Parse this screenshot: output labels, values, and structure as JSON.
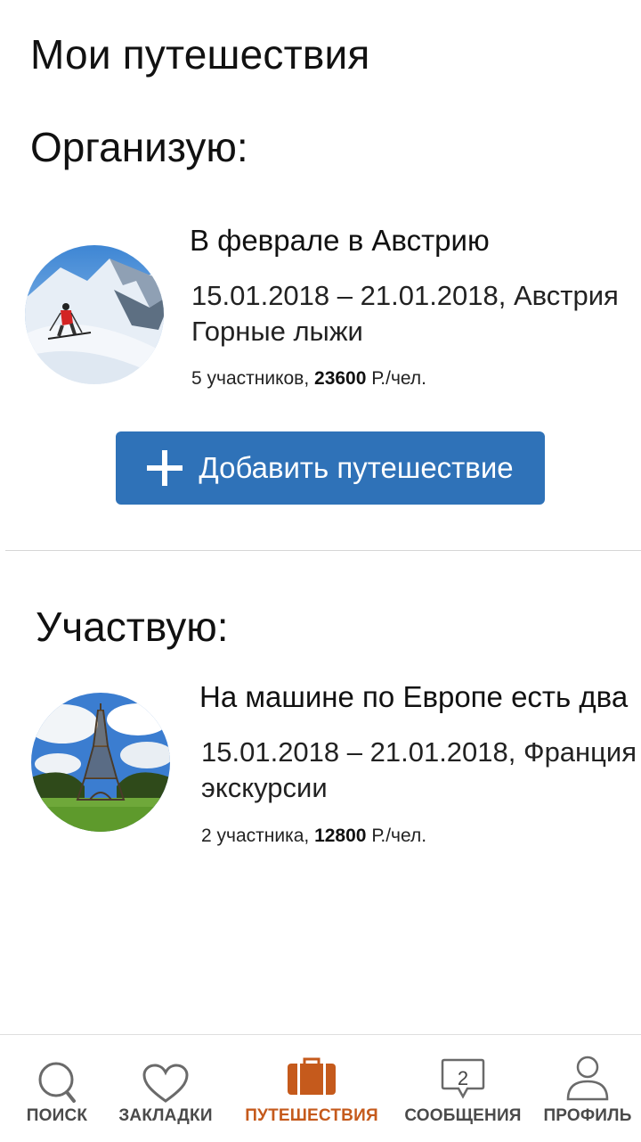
{
  "page": {
    "title": "Мои путешествия"
  },
  "organizing": {
    "section_title": "Организую:",
    "trips": [
      {
        "title": "В феврале в Австрию",
        "dates_location": "15.01.2018 – 21.01.2018, Австрия",
        "category": "Горные лыжи",
        "participants": "5 участников, ",
        "price": "23600",
        "price_unit": " Р./чел."
      }
    ],
    "add_button_label": "Добавить путешествие"
  },
  "participating": {
    "section_title": "Участвую:",
    "trips": [
      {
        "title": "На машине по Европе есть два",
        "dates_location": "15.01.2018 – 21.01.2018, Франция",
        "category": "экскурсии",
        "participants": "2 участника, ",
        "price": "12800",
        "price_unit": " Р./чел."
      }
    ]
  },
  "tabbar": {
    "tabs": [
      {
        "label": "ПОИСК",
        "icon": "search-icon"
      },
      {
        "label": "ЗАКЛАДКИ",
        "icon": "heart-icon"
      },
      {
        "label": "ПУТЕШЕСТВИЯ",
        "icon": "suitcase-icon",
        "active": true
      },
      {
        "label": "СООБЩЕНИЯ",
        "icon": "message-icon",
        "badge": "2"
      },
      {
        "label": "ПРОФИЛЬ",
        "icon": "user-icon"
      }
    ]
  },
  "colors": {
    "accent": "#c55a1c",
    "button": "#2f72b8",
    "icon_gray": "#6a6a6a"
  }
}
